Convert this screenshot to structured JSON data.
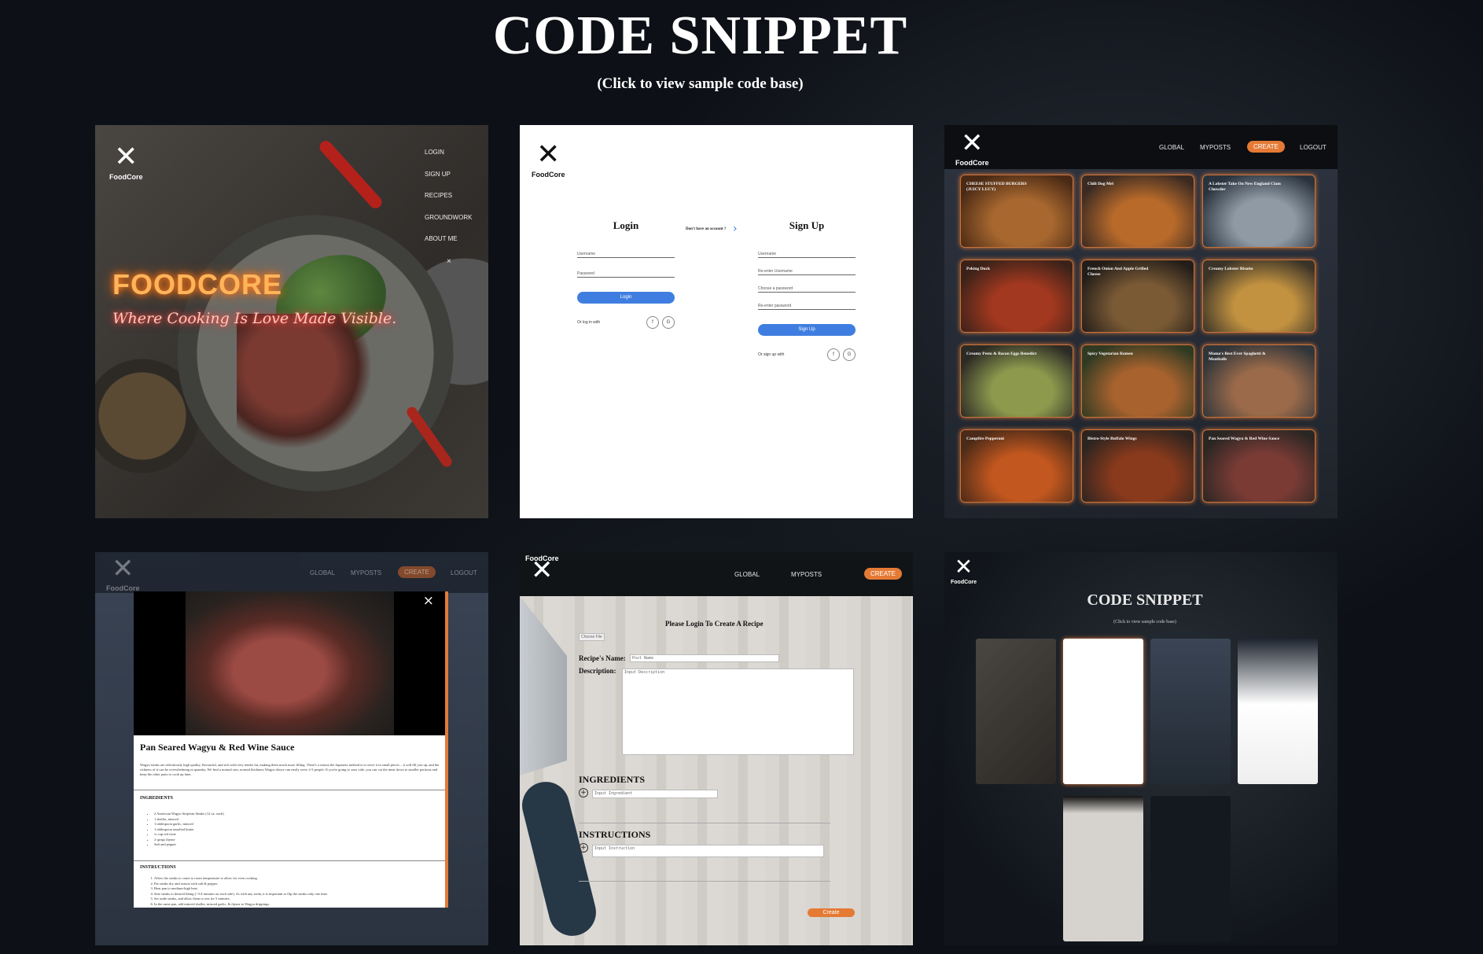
{
  "page": {
    "title": "CODE SNIPPET",
    "subtitle": "(Click to view sample code base)"
  },
  "brand": {
    "name": "FoodCore",
    "accent": "#e57a35"
  },
  "landing": {
    "menu": [
      "LOGIN",
      "SIGN UP",
      "RECIPES",
      "GROUNDWORK",
      "ABOUT ME"
    ],
    "close": "×",
    "neon_title": "FOODCORE",
    "neon_subtitle": "Where Cooking Is Love Made Visible."
  },
  "auth": {
    "login_heading": "Login",
    "signup_heading": "Sign Up",
    "no_account": "Don't have an account ?",
    "arrow": "›",
    "login_fields": [
      "Username",
      "Password"
    ],
    "login_button": "Login",
    "login_social": "Or log in with",
    "signup_fields": [
      "Username",
      "Re-enter Username",
      "Choose a password",
      "Re-enter password"
    ],
    "signup_button": "Sign Up",
    "signup_social": "Or sign up with",
    "facebook": "f",
    "google": "G"
  },
  "nav": {
    "global": "GLOBAL",
    "myposts": "MYPOSTS",
    "create": "CREATE",
    "logout": "LOGOUT"
  },
  "recipes": [
    {
      "title": "CHEESE STUFFED BURGERS (JUICY LUCY)",
      "c1": "#a7672f",
      "c2": "#4a2a15"
    },
    {
      "title": "Chili Dog Mel",
      "c1": "#b86a2a",
      "c2": "#3a2a22"
    },
    {
      "title": "A Lobster Take On New England Clam Chowder",
      "c1": "#8f9aa5",
      "c2": "#2a333d"
    },
    {
      "title": "Peking Duck",
      "c1": "#a2381f",
      "c2": "#3b2219"
    },
    {
      "title": "French Onion And Apple Grilled Cheese",
      "c1": "#7a5a35",
      "c2": "#231d19"
    },
    {
      "title": "Creamy Lobster Risotto",
      "c1": "#c29240",
      "c2": "#3a3328"
    },
    {
      "title": "Creamy Pesto & Bacon Eggs Benedict",
      "c1": "#8d9a4d",
      "c2": "#2c2a25"
    },
    {
      "title": "Spicy Vegetarian Ramen",
      "c1": "#a8622e",
      "c2": "#2f3a22"
    },
    {
      "title": "Mama's Best Ever Spaghetti & Meatballs",
      "c1": "#9a6a4a",
      "c2": "#30353a"
    },
    {
      "title": "Campfire Pepperoni",
      "c1": "#c2571f",
      "c2": "#4a2a18"
    },
    {
      "title": "Bistro-Style Buffalo Wings",
      "c1": "#8a3a1c",
      "c2": "#2d2420"
    },
    {
      "title": "Pan Seared Wagyu & Red Wine Sauce",
      "c1": "#7a3b35",
      "c2": "#2a2623"
    }
  ],
  "modal": {
    "close": "×",
    "title": "Pan Seared Wagyu & Red Wine Sauce",
    "description": "Wagyu steaks are ridiculously high quality, flavourful, and rich with very tender fat, making them much more filling. There's a reason the Japanese method is to serve it in small pieces – it will fill you up, and the richness of it can be overwhelming in quantity. We find a normal size, normal thickness Wagyu ribeye can easily serve 2-3 people. If you're going to sous vide, you can cut the meat down to smaller portions and keep the other parts to cook up later.",
    "ingredients_heading": "INGREDIENTS",
    "ingredients": [
      "2 American Wagyu Striploin Steaks (12 oz. each)",
      "1 shallot, minced",
      "1 tablespoon garlic, minced",
      "1 tablespoon unsalted butter",
      "¼ cup red wine",
      "2 sprigs thyme",
      "Salt and pepper"
    ],
    "instructions_heading": "INSTRUCTIONS",
    "instructions": [
      "Allow the steaks to come to room temperature to allow for even cooking.",
      "Pat steaks dry and season with salt & pepper.",
      "Heat pan to medium-high heat.",
      "Sear steaks to desired liking (~3-4 minutes on each side). As with any steak, it is important to flip the steaks only one time.",
      "Set aside steaks, and allow them to rest for 5 minutes.",
      "In the same pan, add minced shallot, minced garlic, & thyme to Wagyu drippings."
    ]
  },
  "create": {
    "heading": "Please Login To Create A Recipe",
    "choose_file": "Choose File",
    "name_label": "Recipe's Name:",
    "name_placeholder": "Post Name",
    "desc_label": "Description:",
    "desc_placeholder": "Input Description",
    "ingredients_label": "INGREDIENTS",
    "ingredient_placeholder": "Input Ingredient",
    "instructions_label": "INSTRUCTIONS",
    "instruction_placeholder": "Input Instruction",
    "plus": "+",
    "button": "Create"
  },
  "preview": {
    "title": "CODE SNIPPET",
    "subtitle": "(Click to view sample code base)"
  }
}
